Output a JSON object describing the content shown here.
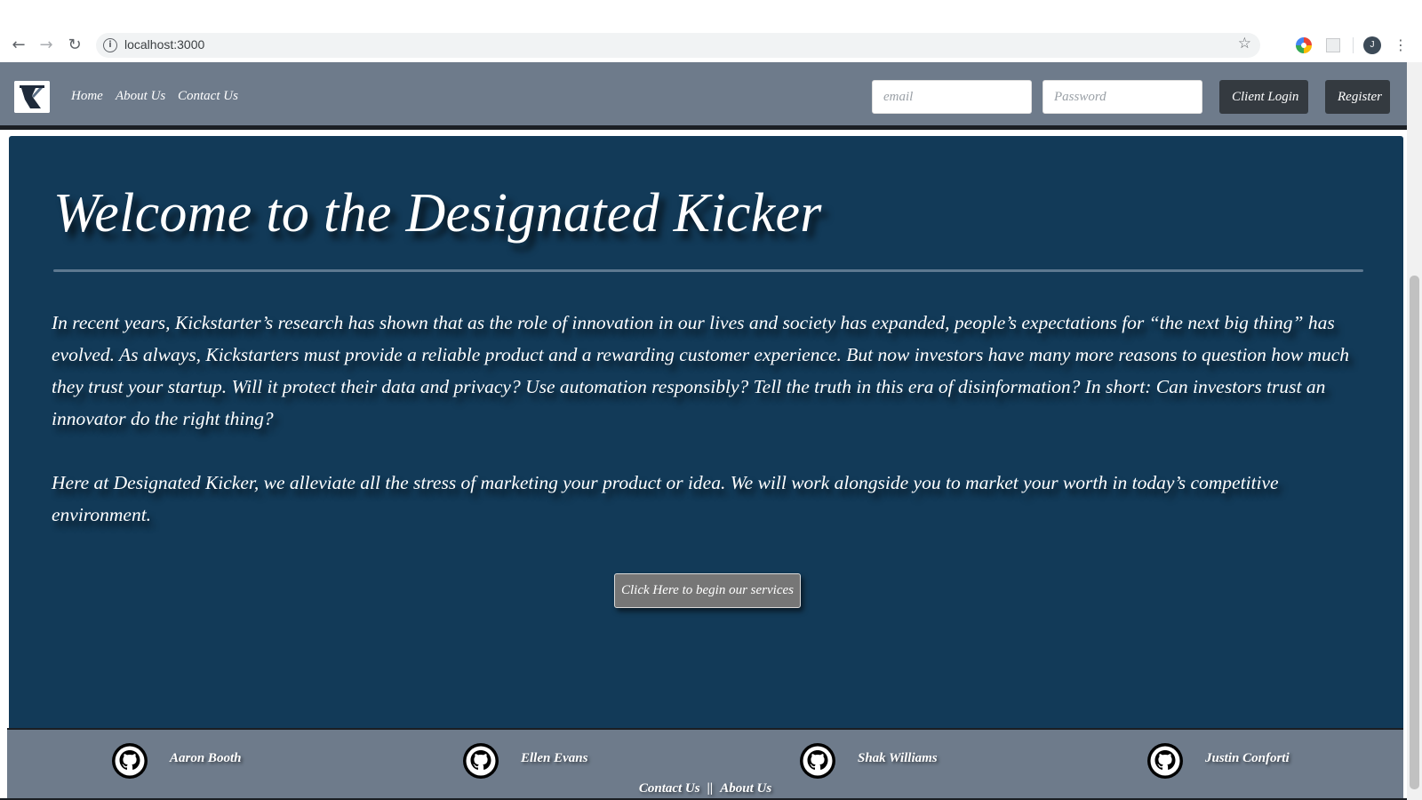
{
  "browser": {
    "url": "localhost:3000",
    "profile_initial": "J",
    "icons": {
      "back": "back-arrow-icon",
      "forward": "forward-arrow-icon",
      "reload": "reload-icon",
      "info": "info-icon",
      "bookmark": "star-icon",
      "menu": "kebab-menu-icon"
    }
  },
  "navbar": {
    "links": [
      "Home",
      "About Us",
      "Contact Us"
    ],
    "email_placeholder": "email",
    "password_placeholder": "Password",
    "login_label": "Client Login",
    "register_label": "Register",
    "background_color": "#6e7b8b"
  },
  "hero": {
    "title": "Welcome to the Designated Kicker",
    "paragraphs": [
      "In recent years, Kickstarter’s research has shown that as the role of innovation in our lives and society has expanded, people’s expectations for “the next big thing” has evolved. As always, Kickstarters must provide a reliable product and a rewarding customer experience. But now investors have many more reasons to question how much they trust your startup. Will it protect their data and privacy? Use automation responsibly? Tell the truth in this era of disinformation? In short: Can investors trust an innovator do the right thing?",
      "Here at Designated Kicker, we alleviate all the stress of marketing your product or idea. We will work alongside you to market your worth in today’s competitive environment."
    ],
    "cta_label": "Click Here to begin our services",
    "background_color": "#123a58"
  },
  "footer": {
    "members": [
      {
        "name": "Aaron Booth",
        "icon": "github-icon"
      },
      {
        "name": "Ellen Evans",
        "icon": "github-icon"
      },
      {
        "name": "Shak Williams",
        "icon": "github-icon"
      },
      {
        "name": "Justin Conforti",
        "icon": "github-icon"
      }
    ],
    "links": [
      "Contact Us",
      "About Us"
    ],
    "separator": "||"
  }
}
